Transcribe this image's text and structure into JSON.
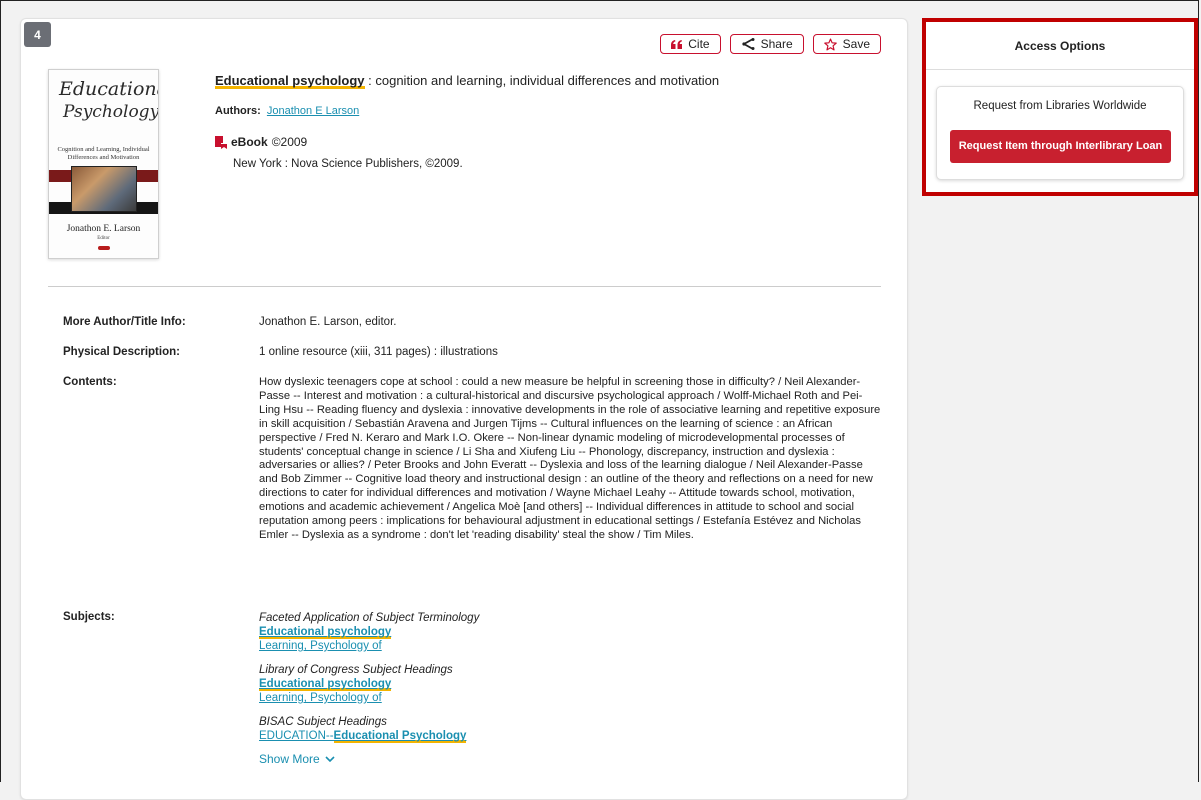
{
  "result": {
    "number": "4"
  },
  "actions": {
    "cite": "Cite",
    "share": "Share",
    "save": "Save"
  },
  "cover": {
    "line1": "Educational",
    "line2": "Psychology",
    "subtitle": "Cognition and Learning, Individual Differences and Motivation",
    "author": "Jonathon E. Larson",
    "editor": "Editor"
  },
  "record": {
    "title_highlight": "Educational psychology",
    "title_rest": " : cognition and learning, individual differences and motivation",
    "authors_label": "Authors:",
    "author_link": "Jonathon E Larson",
    "format": "eBook",
    "year": "©2009",
    "publisher": "New York : Nova Science Publishers, ©2009."
  },
  "details": {
    "more_author_label": "More Author/Title Info:",
    "more_author_value": "Jonathon E. Larson, editor.",
    "physical_label": "Physical Description:",
    "physical_value": "1 online resource (xiii, 311 pages) : illustrations",
    "contents_label": "Contents:",
    "contents_value": "How dyslexic teenagers cope at school : could a new measure be helpful in screening those in difficulty? / Neil Alexander-Passe -- Interest and motivation : a cultural-historical and discursive psychological approach / Wolff-Michael Roth and Pei-Ling Hsu -- Reading fluency and dyslexia : innovative developments in the role of associative learning and repetitive exposure in skill acquisition / Sebastián Aravena and Jurgen Tijms -- Cultural influences on the learning of science : an African perspective / Fred N. Keraro and Mark I.O. Okere -- Non-linear dynamic modeling of microdevelopmental processes of students' conceptual change in science / Li Sha and Xiufeng Liu -- Phonology, discrepancy, instruction and dyslexia : adversaries or allies? / Peter Brooks and John Everatt -- Dyslexia and loss of the learning dialogue / Neil Alexander-Passe and Bob Zimmer -- Cognitive load theory and instructional design : an outline of the theory and reflections on a need for new directions to cater for individual differences and motivation / Wayne Michael Leahy -- Attitude towards school, motivation, emotions and academic achievement / Angelica Moè [and others] -- Individual differences in attitude to school and social reputation among peers : implications for behavioural adjustment in educational settings / Estefanía Estévez and Nicholas Emler -- Dyslexia as a syndrome : don't let 'reading disability' steal the show / Tim Miles.",
    "subjects_label": "Subjects:",
    "subjects": {
      "group1_heading": "Faceted Application of Subject Terminology",
      "group1_link1": "Educational psychology",
      "group1_link2": "Learning, Psychology of",
      "group2_heading": "Library of Congress Subject Headings",
      "group2_link1": "Educational psychology",
      "group2_link2": "Learning, Psychology of",
      "group3_heading": "BISAC Subject Headings",
      "group3_link1_prefix": "EDUCATION--",
      "group3_link1_bold": "Educational Psychology"
    },
    "show_more": "Show More"
  },
  "access": {
    "header": "Access Options",
    "card_title": "Request from Libraries Worldwide",
    "ill_button": "Request Item through Interlibrary Loan"
  },
  "colors": {
    "accent_red": "#c8202f",
    "link_blue": "#1a8fb0",
    "highlight_yellow": "#f4b400",
    "panel_border": "#c00000"
  }
}
